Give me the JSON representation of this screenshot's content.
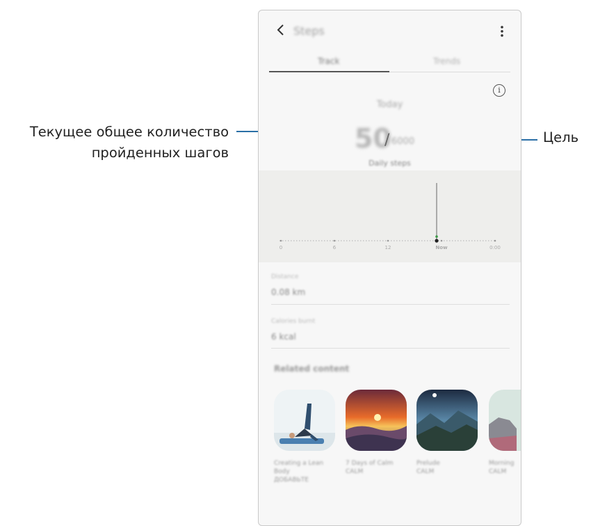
{
  "annotations": {
    "left_line1": "Текущее общее количество",
    "left_line2": "пройденных шагов",
    "right": "Цель"
  },
  "header": {
    "title": "Steps"
  },
  "tabs": [
    {
      "label": "Track"
    },
    {
      "label": "Trends"
    }
  ],
  "summary": {
    "today_label": "Today",
    "step_count": "50",
    "slash": "/",
    "goal": "6000",
    "daily_steps_label": "Daily steps"
  },
  "chart_data": {
    "type": "bar",
    "categories": [
      "0",
      "6",
      "12",
      "Now",
      "0:00"
    ],
    "highlight": "Now"
  },
  "stats": [
    {
      "label": "Distance",
      "value": "0.08 km"
    },
    {
      "label": "Calories burnt",
      "value": "6 kcal"
    }
  ],
  "related": {
    "title": "Related content",
    "cards": [
      {
        "title": "Creating a Lean Body",
        "subtitle": "ДОБАВЬТЕ"
      },
      {
        "title": "7 Days of Calm",
        "subtitle": "CALM"
      },
      {
        "title": "Prelude",
        "subtitle": "CALM"
      },
      {
        "title": "Morning",
        "subtitle": "CALM"
      }
    ]
  },
  "colors": {
    "accent_leader": "#2a6fa6",
    "chart_bg": "#eeeeec",
    "marker": "#3a9a45"
  }
}
